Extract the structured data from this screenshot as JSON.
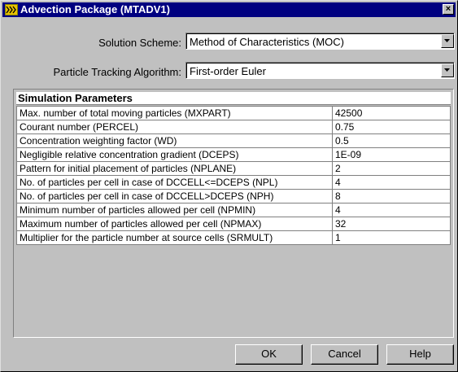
{
  "window": {
    "title": "Advection Package (MTADV1)",
    "close_glyph": "×"
  },
  "form": {
    "solution_scheme": {
      "label": "Solution Scheme:",
      "value": "Method of Characteristics (MOC)"
    },
    "particle_tracking": {
      "label": "Particle Tracking Algorithm:",
      "value": "First-order Euler"
    }
  },
  "parameters": {
    "header": "Simulation Parameters",
    "rows": [
      {
        "label": "Max. number of total moving particles (MXPART)",
        "value": "42500"
      },
      {
        "label": "Courant number (PERCEL)",
        "value": "0.75"
      },
      {
        "label": "Concentration weighting factor (WD)",
        "value": "0.5"
      },
      {
        "label": "Negligible relative concentration gradient (DCEPS)",
        "value": "1E-09"
      },
      {
        "label": "Pattern for initial placement of particles (NPLANE)",
        "value": "2"
      },
      {
        "label": "No. of particles per cell in case of DCCELL<=DCEPS (NPL)",
        "value": "4"
      },
      {
        "label": "No. of particles per cell in case of DCCELL>DCEPS (NPH)",
        "value": "8"
      },
      {
        "label": "Minimum number of particles allowed per cell (NPMIN)",
        "value": "4"
      },
      {
        "label": "Maximum number of particles allowed per cell (NPMAX)",
        "value": "32"
      },
      {
        "label": "Multiplier for the particle number at source cells (SRMULT)",
        "value": "1"
      }
    ]
  },
  "buttons": {
    "ok": "OK",
    "cancel": "Cancel",
    "help": "Help"
  },
  "icons": {
    "app": "app-icon",
    "close": "close-icon",
    "dropdown": "chevron-down-icon"
  },
  "colors": {
    "titlebar": "#000080",
    "face": "#c0c0c0",
    "app_icon": "#e8c000"
  }
}
